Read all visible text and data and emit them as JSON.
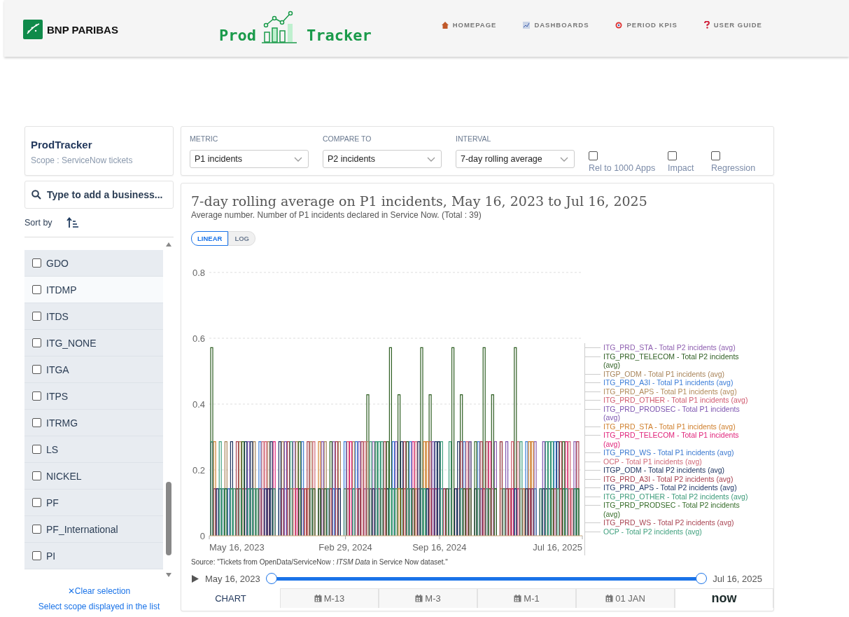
{
  "header": {
    "brand": "BNP PARIBAS",
    "logo": {
      "left": "Prod",
      "right": "Tracker"
    },
    "nav": [
      {
        "kind": "home",
        "label": "HOMEPAGE"
      },
      {
        "kind": "chart",
        "label": "DASHBOARDS"
      },
      {
        "kind": "target",
        "label": "PERIOD KPIS"
      },
      {
        "kind": "help",
        "label": "USER GUIDE"
      }
    ]
  },
  "sidebar": {
    "title": "ProdTracker",
    "scope": "Scope : ServiceNow tickets",
    "search": {
      "placeholder": "Type to add a business..."
    },
    "sort_label": "Sort by",
    "items": [
      {
        "label": "GDO",
        "checked": false,
        "hovered": false
      },
      {
        "label": "ITDMP",
        "checked": false,
        "hovered": true
      },
      {
        "label": "ITDS",
        "checked": false,
        "hovered": false
      },
      {
        "label": "ITG_NONE",
        "checked": false,
        "hovered": false
      },
      {
        "label": "ITGA",
        "checked": false,
        "hovered": false
      },
      {
        "label": "ITPS",
        "checked": false,
        "hovered": false
      },
      {
        "label": "ITRMG",
        "checked": false,
        "hovered": false
      },
      {
        "label": "LS",
        "checked": false,
        "hovered": false
      },
      {
        "label": "NICKEL",
        "checked": false,
        "hovered": false
      },
      {
        "label": "PF",
        "checked": false,
        "hovered": false
      },
      {
        "label": "PF_International",
        "checked": false,
        "hovered": false
      },
      {
        "label": "PI",
        "checked": false,
        "hovered": false
      }
    ],
    "clear_link": "✕Clear selection",
    "select_link": "Select scope displayed in the list"
  },
  "controls": {
    "selects": [
      {
        "label": "METRIC",
        "value": "P1 incidents"
      },
      {
        "label": "COMPARE TO",
        "value": "P2 incidents"
      },
      {
        "label": "INTERVAL",
        "value": "7-day rolling average"
      }
    ],
    "checkboxes": [
      {
        "label": "Rel to 1000 Apps",
        "checked": false
      },
      {
        "label": "Impact",
        "checked": false
      },
      {
        "label": "Regression",
        "checked": false
      }
    ]
  },
  "chart_panel": {
    "title": "7-day rolling average on P1 incidents, May 16, 2023 to Jul 16, 2025",
    "subtitle": "Average number. Number of P1 incidents declared in Service Now. (Total : 39)",
    "scales": [
      {
        "label": "LINEAR",
        "selected": true
      },
      {
        "label": "LOG",
        "selected": false
      }
    ],
    "chart": {
      "y_tick_labels": [
        "0.8",
        "0.6",
        "0.4",
        "0.2",
        "0"
      ],
      "x_tick_labels": [
        "May 16, 2023",
        "Feb 29, 2024",
        "Sep 16, 2024",
        "Jul 16, 2025"
      ],
      "legend": [
        {
          "name": "ITG_PRD_STA - Total P2 incidents (avg)",
          "color": "#8e5fb0"
        },
        {
          "name": "ITG_PRD_TELECOM - Total P2 incidents (avg)",
          "color": "#2e5e22"
        },
        {
          "name": "ITGP_ODM - Total P1 incidents (avg)",
          "color": "#a8845a"
        },
        {
          "name": "ITG_PRD_A3I - Total P1 incidents (avg)",
          "color": "#3b7dd8"
        },
        {
          "name": "ITG_PRD_APS - Total P1 incidents (avg)",
          "color": "#b08a5a"
        },
        {
          "name": "ITG_PRD_OTHER - Total P1 incidents (avg)",
          "color": "#d05a6e"
        },
        {
          "name": "ITG_PRD_PRODSEC - Total P1 incidents (avg)",
          "color": "#7d55b0"
        },
        {
          "name": "ITG_PRD_STA - Total P1 incidents (avg)",
          "color": "#d0802e"
        },
        {
          "name": "ITG_PRD_TELECOM - Total P1 incidents (avg)",
          "color": "#e0237a"
        },
        {
          "name": "ITG_PRD_WS - Total P1 incidents (avg)",
          "color": "#3a78d0"
        },
        {
          "name": "OCP - Total P1 incidents (avg)",
          "color": "#d06a78"
        },
        {
          "name": "ITGP_ODM - Total P2 incidents (avg)",
          "color": "#1f3560"
        },
        {
          "name": "ITG_PRD_A3I - Total P2 incidents (avg)",
          "color": "#a8404f"
        },
        {
          "name": "ITG_PRD_APS - Total P2 incidents (avg)",
          "color": "#23396a"
        },
        {
          "name": "ITG_PRD_OTHER - Total P2 incidents (avg)",
          "color": "#3a9a78"
        },
        {
          "name": "ITG_PRD_PRODSEC - Total P2 incidents (avg)",
          "color": "#356b28"
        },
        {
          "name": "ITG_PRD_WS - Total P2 incidents (avg)",
          "color": "#a94452"
        },
        {
          "name": "OCP - Total P2 incidents (avg)",
          "color": "#40a07e"
        }
      ]
    },
    "source": "Source: \"Tickets from OpenData/ServiceNow : *ITSM Data* in Service Now dataset.\"",
    "range": {
      "start": {
        "label": "May 16, 2023",
        "level": 0
      },
      "end": {
        "label": "Jul 16, 2025",
        "level": 1
      }
    },
    "tabs": [
      {
        "kind": "text",
        "label": "CHART",
        "selected": true
      },
      {
        "kind": "calendar",
        "label": "M-13",
        "selected": false
      },
      {
        "kind": "calendar",
        "label": "M-3",
        "selected": false
      },
      {
        "kind": "calendar",
        "label": "M-1",
        "selected": false
      },
      {
        "kind": "calendar",
        "label": "01 JAN",
        "selected": false
      },
      {
        "kind": "logo",
        "label": "now",
        "selected": false
      }
    ]
  }
}
